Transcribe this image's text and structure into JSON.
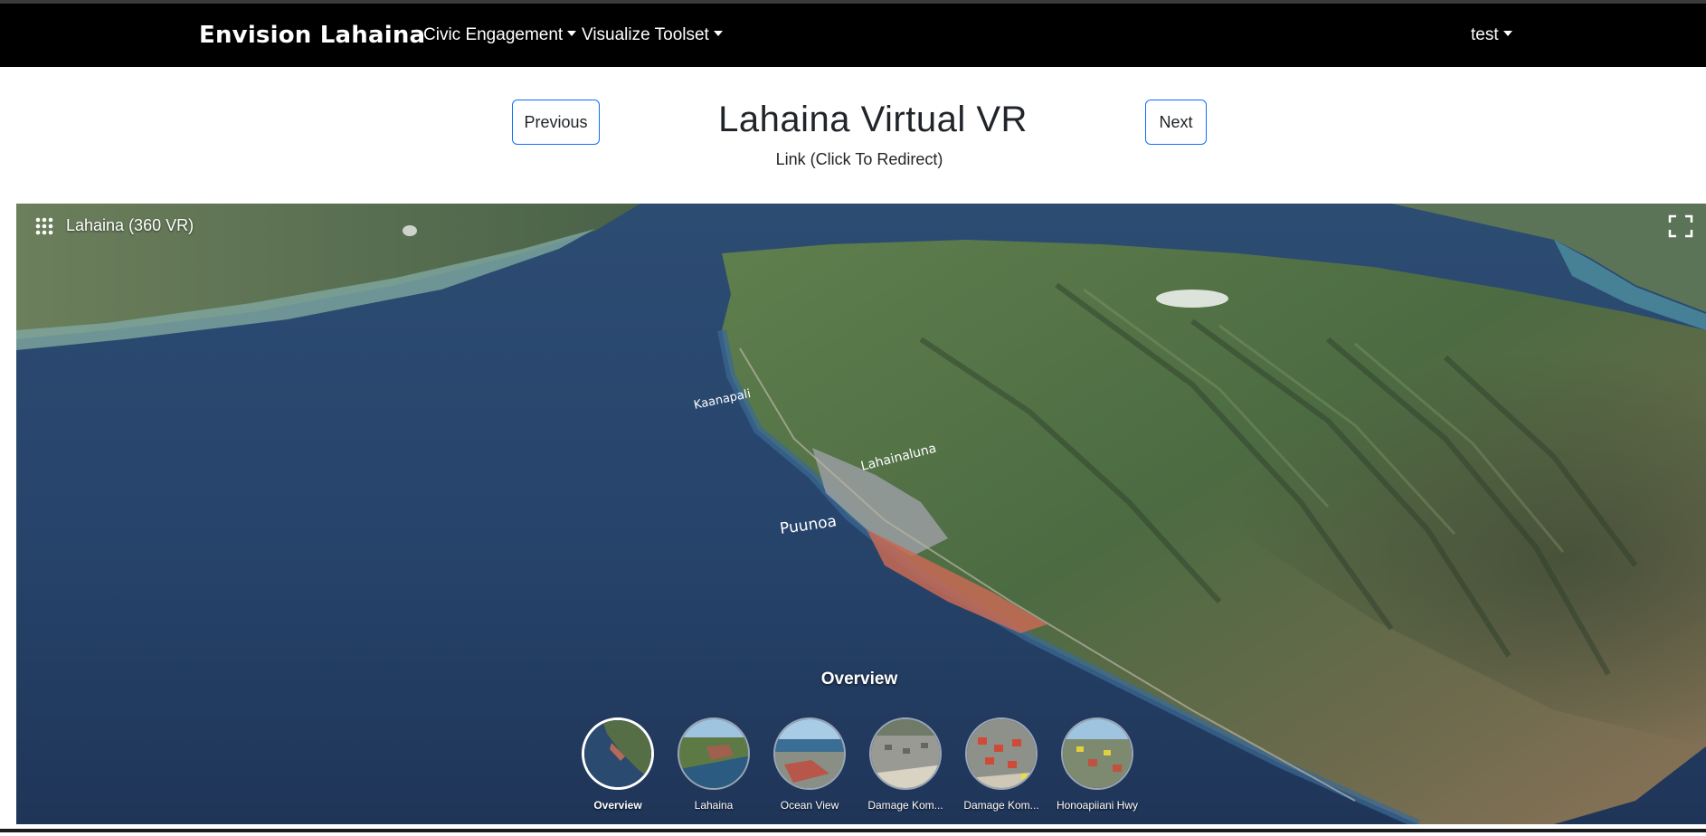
{
  "navbar": {
    "brand": "Envision Lahaina",
    "menus": [
      "Civic Engagement",
      "Visualize Toolset"
    ],
    "user": "test"
  },
  "header": {
    "previous_label": "Previous",
    "next_label": "Next",
    "title": "Lahaina Virtual VR",
    "link_text": "Link (Click To Redirect)"
  },
  "viewer": {
    "title": "Lahaina (360 VR)",
    "current_scene": "Overview",
    "map_labels": [
      "Kaanapali",
      "Lahainaluna",
      "Puunoa"
    ],
    "scenes": [
      {
        "label": "Overview",
        "active": true
      },
      {
        "label": "Lahaina",
        "active": false
      },
      {
        "label": "Ocean View",
        "active": false
      },
      {
        "label": "Damage Kom...",
        "active": false
      },
      {
        "label": "Damage Kom...",
        "active": false
      },
      {
        "label": "Honoapiiani Hwy",
        "active": false
      }
    ],
    "icons": [
      "grid-icon",
      "fullscreen-icon"
    ]
  },
  "colors": {
    "navbar": "#000000",
    "button_border": "#0d6efd",
    "ocean": "#27456c",
    "land": "#4e6e44"
  }
}
